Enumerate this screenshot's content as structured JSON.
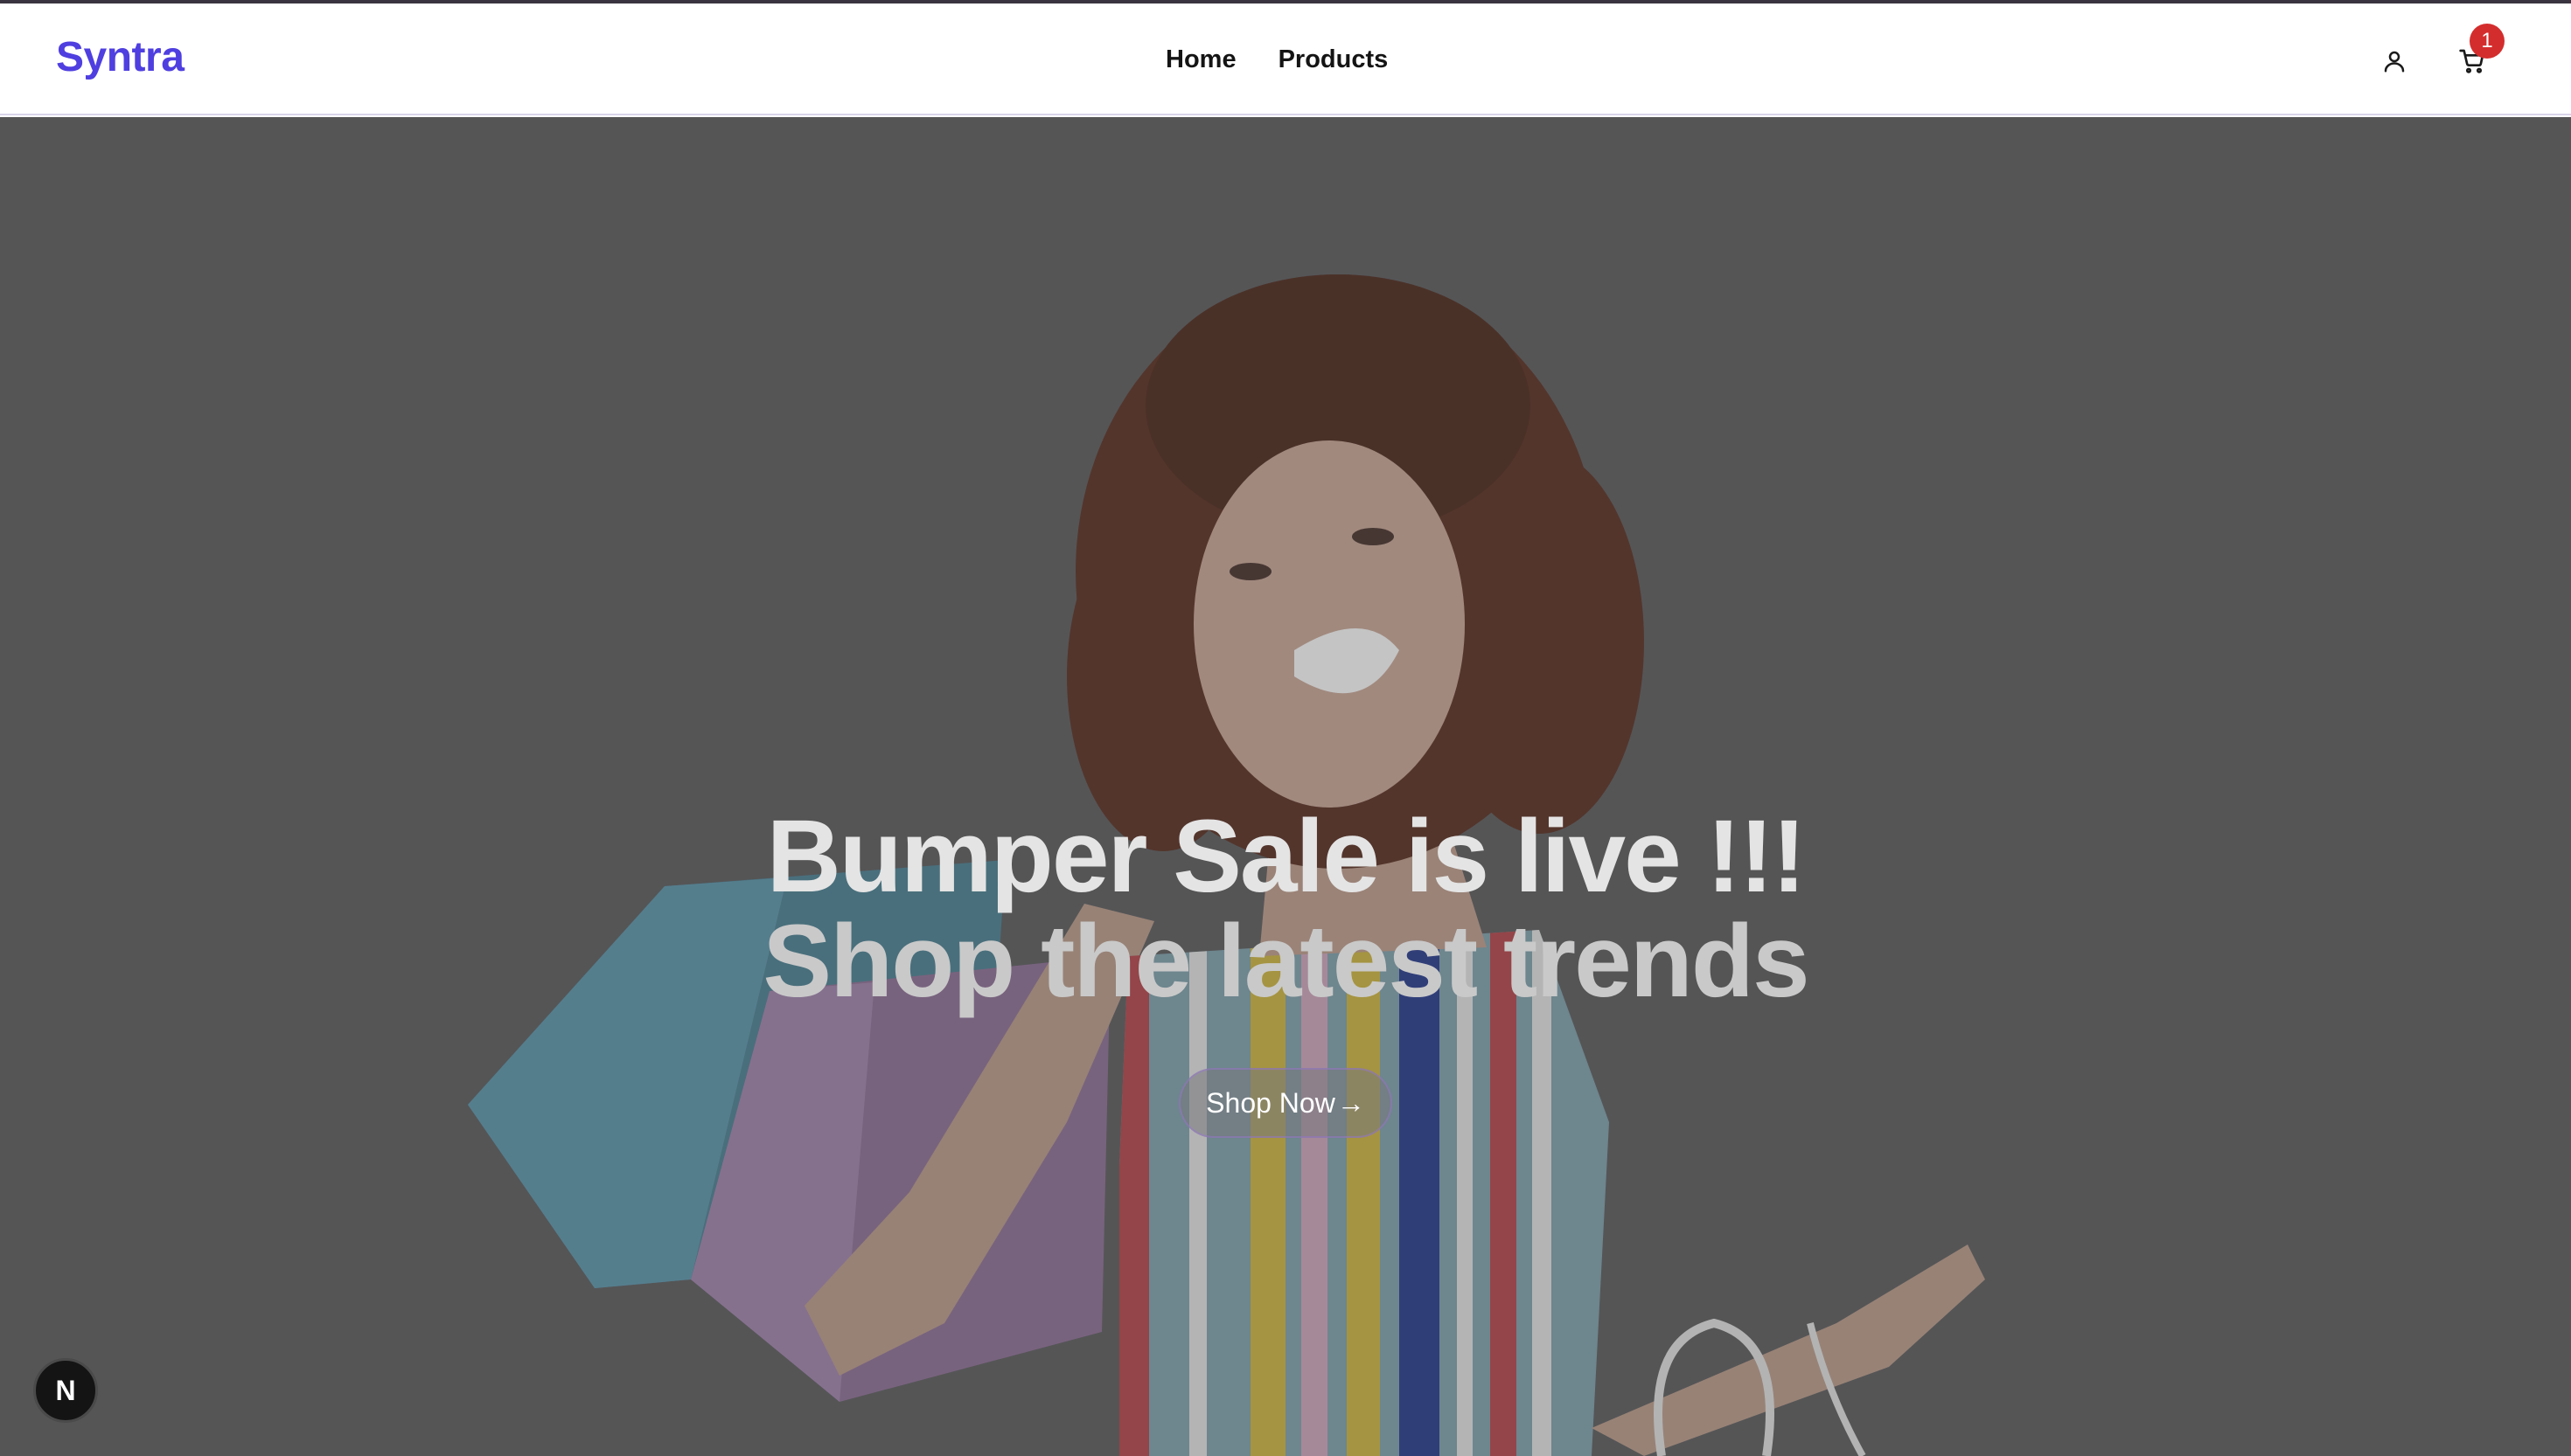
{
  "header": {
    "logo": "Syntra",
    "nav": [
      {
        "label": "Home"
      },
      {
        "label": "Products"
      }
    ],
    "cart_count": "1",
    "icons": {
      "account": "user-icon",
      "cart": "cart-icon"
    }
  },
  "hero": {
    "line1": "Bumper Sale is live !!!",
    "line2": "Shop the latest trends",
    "cta_label": "Shop Now",
    "cta_arrow": "→"
  },
  "dev_badge": {
    "letter": "N"
  },
  "colors": {
    "brand": "#4f3fe0",
    "badge": "#d42d2d",
    "overlay": "#5f5f60"
  }
}
